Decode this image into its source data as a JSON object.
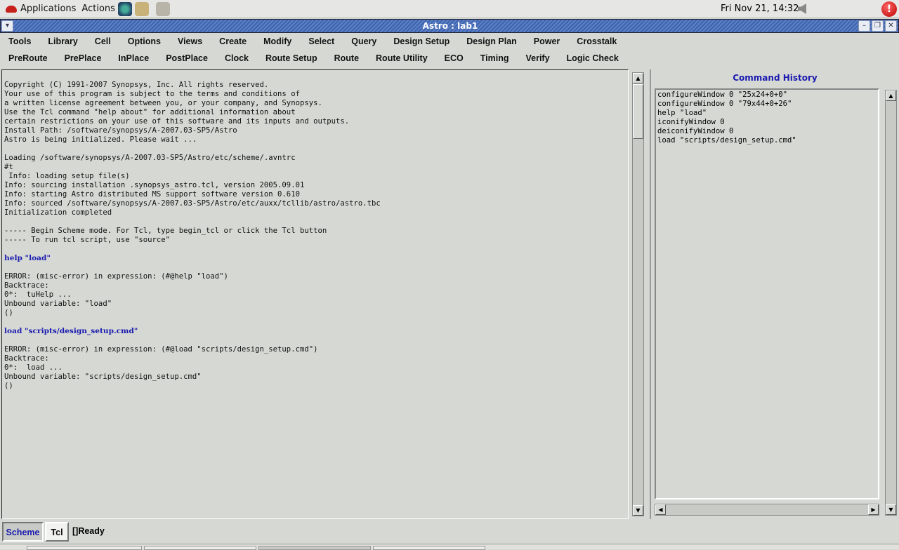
{
  "top_panel": {
    "applications": "Applications",
    "actions": "Actions",
    "clock": "Fri Nov 21, 14:32"
  },
  "window": {
    "title": "Astro : lab1"
  },
  "menu_row1": [
    "Tools",
    "Library",
    "Cell",
    "Options",
    "Views",
    "Create",
    "Modify",
    "Select",
    "Query",
    "Design Setup",
    "Design Plan",
    "Power",
    "Crosstalk"
  ],
  "menu_row2": [
    "PreRoute",
    "PrePlace",
    "InPlace",
    "PostPlace",
    "Clock",
    "Route Setup",
    "Route",
    "Route Utility",
    "ECO",
    "Timing",
    "Verify",
    "Logic Check"
  ],
  "console": {
    "lines": [
      {
        "t": "Copyright (C) 1991-2007 Synopsys, Inc. All rights reserved."
      },
      {
        "t": "Your use of this program is subject to the terms and conditions of"
      },
      {
        "t": "a written license agreement between you, or your company, and Synopsys."
      },
      {
        "t": "Use the Tcl command \"help about\" for additional information about"
      },
      {
        "t": "certain restrictions on your use of this software and its inputs and outputs."
      },
      {
        "t": "Install Path: /software/synopsys/A-2007.03-SP5/Astro"
      },
      {
        "t": "Astro is being initialized. Please wait ..."
      },
      {
        "t": ""
      },
      {
        "t": "Loading /software/synopsys/A-2007.03-SP5/Astro/etc/scheme/.avntrc"
      },
      {
        "t": "#t"
      },
      {
        "t": " Info: loading setup file(s)"
      },
      {
        "t": "Info: sourcing installation .synopsys_astro.tcl, version 2005.09.01"
      },
      {
        "t": "Info: starting Astro distributed MS support software version 0.610"
      },
      {
        "t": "Info: sourced /software/synopsys/A-2007.03-SP5/Astro/etc/auxx/tcllib/astro/astro.tbc"
      },
      {
        "t": "Initialization completed"
      },
      {
        "t": ""
      },
      {
        "t": "----- Begin Scheme mode. For Tcl, type begin_tcl or click the Tcl button"
      },
      {
        "t": "----- To run tcl script, use \"source\""
      },
      {
        "t": ""
      },
      {
        "t": "help \"load\"",
        "cmd": true
      },
      {
        "t": ""
      },
      {
        "t": "ERROR: (misc-error) in expression: (#@help \"load\")"
      },
      {
        "t": "Backtrace:"
      },
      {
        "t": "0*:  tuHelp ..."
      },
      {
        "t": "Unbound variable: \"load\""
      },
      {
        "t": "()"
      },
      {
        "t": ""
      },
      {
        "t": "load \"scripts/design_setup.cmd\"",
        "cmd": true
      },
      {
        "t": ""
      },
      {
        "t": "ERROR: (misc-error) in expression: (#@load \"scripts/design_setup.cmd\")"
      },
      {
        "t": "Backtrace:"
      },
      {
        "t": "0*:  load ..."
      },
      {
        "t": "Unbound variable: \"scripts/design_setup.cmd\""
      },
      {
        "t": "()"
      }
    ]
  },
  "history": {
    "title": "Command History",
    "items": [
      "configureWindow 0 \"25x24+0+0\"",
      "configureWindow 0 \"79x44+0+26\"",
      "help \"load\"",
      "iconifyWindow 0",
      "deiconifyWindow 0",
      "load \"scripts/design_setup.cmd\""
    ]
  },
  "status": {
    "scheme": "Scheme",
    "tcl": "Tcl",
    "message": "[]Ready"
  },
  "colors": {
    "accent": "#1a1ab0",
    "titlebar": "#4a6fb5",
    "background": "#d6d9d3"
  }
}
